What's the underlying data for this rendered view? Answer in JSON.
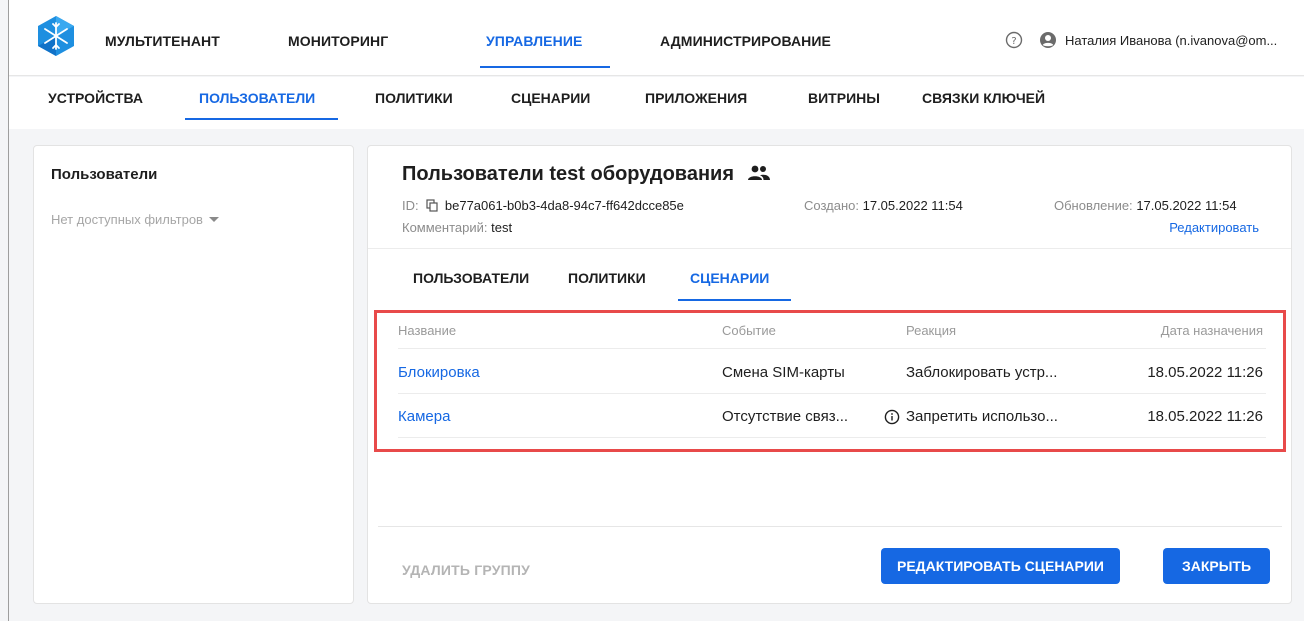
{
  "header": {
    "logo_name": "snowflake-logo",
    "nav": [
      "МУЛЬТИТЕНАНТ",
      "МОНИТОРИНГ",
      "УПРАВЛЕНИЕ",
      "АДМИНИСТРИРОВАНИЕ"
    ],
    "active_nav_index": 2,
    "user": "Наталия Иванова (n.ivanova@om..."
  },
  "subnav": {
    "items": [
      "УСТРОЙСТВА",
      "ПОЛЬЗОВАТЕЛИ",
      "ПОЛИТИКИ",
      "СЦЕНАРИИ",
      "ПРИЛОЖЕНИЯ",
      "ВИТРИНЫ",
      "СВЯЗКИ КЛЮЧЕЙ"
    ],
    "active_index": 1
  },
  "left_panel": {
    "title": "Пользователи",
    "filter": "Нет доступных фильтров"
  },
  "group": {
    "title": "Пользователи test оборудования",
    "id_label": "ID:",
    "id_value": "be77a061-b0b3-4da8-94c7-ff642dcce85e",
    "created_label": "Создано:",
    "created_value": "17.05.2022 11:54",
    "updated_label": "Обновление:",
    "updated_value": "17.05.2022 11:54",
    "comment_label": "Комментарий:",
    "comment_value": "test",
    "edit_link": "Редактировать"
  },
  "tabs": [
    "ПОЛЬЗОВАТЕЛИ",
    "ПОЛИТИКИ",
    "СЦЕНАРИИ"
  ],
  "active_tab_index": 2,
  "table": {
    "columns": [
      "Название",
      "Событие",
      "Реакция",
      "Дата назначения"
    ],
    "rows": [
      {
        "name": "Блокировка",
        "event": "Смена SIM-карты",
        "reaction": "Заблокировать устр...",
        "date": "18.05.2022 11:26"
      },
      {
        "name": "Камера",
        "event": "Отсутствие связ...",
        "reaction": "Запретить использо...",
        "date": "18.05.2022 11:26"
      }
    ]
  },
  "footer": {
    "delete_label": "УДАЛИТЬ ГРУППУ",
    "edit_scenarios_label": "РЕДАКТИРОВАТЬ СЦЕНАРИИ",
    "close_label": "ЗАКРЫТЬ"
  },
  "colors": {
    "accent": "#1668e3",
    "highlight": "#e84a4a",
    "background": "#f4f5f7"
  }
}
